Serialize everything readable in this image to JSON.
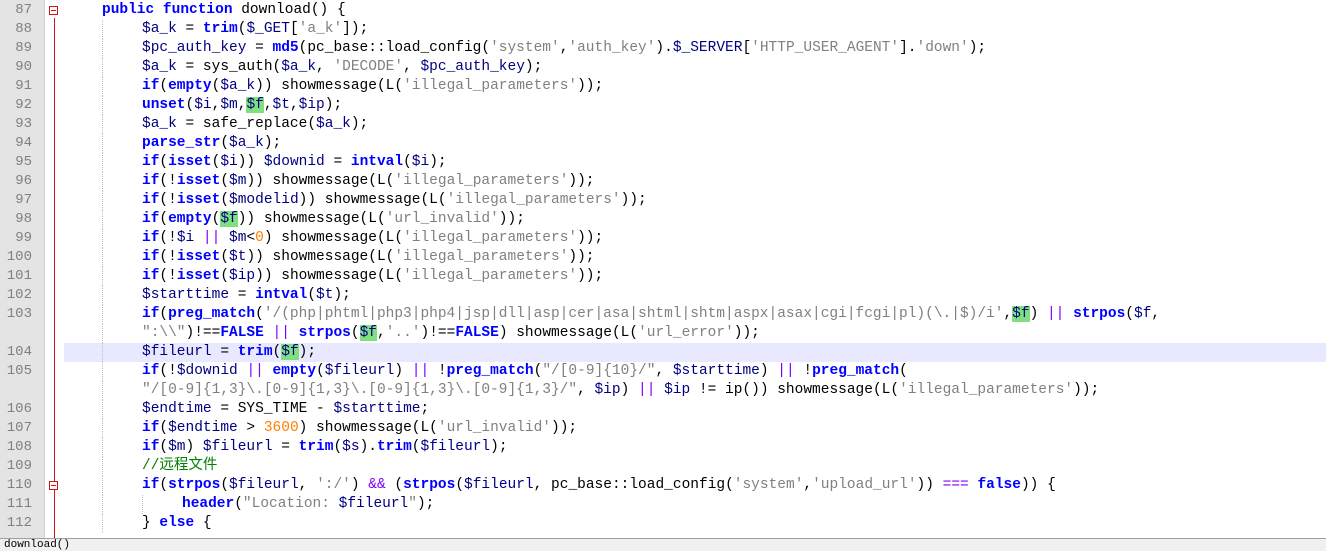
{
  "editor": {
    "fold_markers": [
      87,
      110
    ],
    "current_line": 104,
    "lines": [
      {
        "n": "87",
        "h": "<span class=\"kw\">public function</span> download() {",
        "indent": 1
      },
      {
        "n": "88",
        "h": "<span class=\"var\">$a_k</span> = <span class=\"kw\">trim</span>(<span class=\"var\">$_GET</span>[<span class=\"str\">'a_k'</span>]);",
        "indent": 2
      },
      {
        "n": "89",
        "h": "<span class=\"var\">$pc_auth_key</span> = <span class=\"kw\">md5</span>(pc_base::load_config(<span class=\"str\">'system'</span>,<span class=\"str\">'auth_key'</span>).<span class=\"var\">$_SERVER</span>[<span class=\"str\">'HTTP_USER_AGENT'</span>].<span class=\"str\">'down'</span>);",
        "indent": 2
      },
      {
        "n": "90",
        "h": "<span class=\"var\">$a_k</span> = sys_auth(<span class=\"var\">$a_k</span>, <span class=\"str\">'DECODE'</span>, <span class=\"var\">$pc_auth_key</span>);",
        "indent": 2
      },
      {
        "n": "91",
        "h": "<span class=\"kw\">if</span>(<span class=\"kw\">empty</span>(<span class=\"var\">$a_k</span>)) showmessage(L(<span class=\"str\">'illegal_parameters'</span>));",
        "indent": 2
      },
      {
        "n": "92",
        "h": "<span class=\"kw\">unset</span>(<span class=\"var\">$i</span>,<span class=\"var\">$m</span>,<span class=\"var hl\">$f</span>,<span class=\"var\">$t</span>,<span class=\"var\">$ip</span>);",
        "indent": 2
      },
      {
        "n": "93",
        "h": "<span class=\"var\">$a_k</span> = safe_replace(<span class=\"var\">$a_k</span>);",
        "indent": 2
      },
      {
        "n": "94",
        "h": "<span class=\"kw\">parse_str</span>(<span class=\"var\">$a_k</span>);",
        "indent": 2
      },
      {
        "n": "95",
        "h": "<span class=\"kw\">if</span>(<span class=\"kw\">isset</span>(<span class=\"var\">$i</span>)) <span class=\"var\">$downid</span> = <span class=\"kw\">intval</span>(<span class=\"var\">$i</span>);",
        "indent": 2
      },
      {
        "n": "96",
        "h": "<span class=\"kw\">if</span>(!<span class=\"kw\">isset</span>(<span class=\"var\">$m</span>)) showmessage(L(<span class=\"str\">'illegal_parameters'</span>));",
        "indent": 2
      },
      {
        "n": "97",
        "h": "<span class=\"kw\">if</span>(!<span class=\"kw\">isset</span>(<span class=\"var\">$modelid</span>)) showmessage(L(<span class=\"str\">'illegal_parameters'</span>));",
        "indent": 2
      },
      {
        "n": "98",
        "h": "<span class=\"kw\">if</span>(<span class=\"kw\">empty</span>(<span class=\"var hl\">$f</span>)) showmessage(L(<span class=\"str\">'url_invalid'</span>));",
        "indent": 2
      },
      {
        "n": "99",
        "h": "<span class=\"kw\">if</span>(!<span class=\"var\">$i</span> <span class=\"op\">||</span> <span class=\"var\">$m</span>&lt;<span class=\"num\">0</span>) showmessage(L(<span class=\"str\">'illegal_parameters'</span>));",
        "indent": 2
      },
      {
        "n": "100",
        "h": "<span class=\"kw\">if</span>(!<span class=\"kw\">isset</span>(<span class=\"var\">$t</span>)) showmessage(L(<span class=\"str\">'illegal_parameters'</span>));",
        "indent": 2
      },
      {
        "n": "101",
        "h": "<span class=\"kw\">if</span>(!<span class=\"kw\">isset</span>(<span class=\"var\">$ip</span>)) showmessage(L(<span class=\"str\">'illegal_parameters'</span>));",
        "indent": 2
      },
      {
        "n": "102",
        "h": "<span class=\"var\">$starttime</span> = <span class=\"kw\">intval</span>(<span class=\"var\">$t</span>);",
        "indent": 2
      },
      {
        "n": "103",
        "h": "<span class=\"kw\">if</span>(<span class=\"kw\">preg_match</span>(<span class=\"str\">'/(php|phtml|php3|php4|jsp|dll|asp|cer|asa|shtml|shtm|aspx|asax|cgi|fcgi|pl)(\\.|$)/i'</span>,<span class=\"var hl\">$f</span>) <span class=\"op\">||</span> <span class=\"kw\">strpos</span>(<span class=\"var\">$f</span>,",
        "indent": 2
      },
      {
        "n": "",
        "h": "<span class=\"str\">\":\\\\\"</span>)!==<span class=\"kw\">FALSE</span> <span class=\"op\">||</span> <span class=\"kw\">strpos</span>(<span class=\"var hl\">$f</span>,<span class=\"str\">'..'</span>)!==<span class=\"kw\">FALSE</span>) showmessage(L(<span class=\"str\">'url_error'</span>));",
        "indent": 2
      },
      {
        "n": "104",
        "h": "<span class=\"var\">$fileurl</span> = <span class=\"kw\">trim</span>(<span class=\"var hl\">$f</span>);",
        "indent": 2
      },
      {
        "n": "105",
        "h": "<span class=\"kw\">if</span>(!<span class=\"var\">$downid</span> <span class=\"op\">||</span> <span class=\"kw\">empty</span>(<span class=\"var\">$fileurl</span>) <span class=\"op\">||</span> !<span class=\"kw\">preg_match</span>(<span class=\"str\">\"/[0-9]{10}/\"</span>, <span class=\"var\">$starttime</span>) <span class=\"op\">||</span> !<span class=\"kw\">preg_match</span>(",
        "indent": 2
      },
      {
        "n": "",
        "h": "<span class=\"str\">\"/[0-9]{1,3}\\.[0-9]{1,3}\\.[0-9]{1,3}\\.[0-9]{1,3}/\"</span>, <span class=\"var\">$ip</span>) <span class=\"op\">||</span> <span class=\"var\">$ip</span> != ip()) showmessage(L(<span class=\"str\">'illegal_parameters'</span>));",
        "indent": 2
      },
      {
        "n": "106",
        "h": "<span class=\"var\">$endtime</span> = SYS_TIME - <span class=\"var\">$starttime</span>;",
        "indent": 2
      },
      {
        "n": "107",
        "h": "<span class=\"kw\">if</span>(<span class=\"var\">$endtime</span> &gt; <span class=\"num\">3600</span>) showmessage(L(<span class=\"str\">'url_invalid'</span>));",
        "indent": 2
      },
      {
        "n": "108",
        "h": "<span class=\"kw\">if</span>(<span class=\"var\">$m</span>) <span class=\"var\">$fileurl</span> = <span class=\"kw\">trim</span>(<span class=\"var\">$s</span>).<span class=\"kw\">trim</span>(<span class=\"var\">$fileurl</span>);",
        "indent": 2
      },
      {
        "n": "109",
        "h": "<span class=\"cm\">//远程文件</span>",
        "indent": 2
      },
      {
        "n": "110",
        "h": "<span class=\"kw\">if</span>(<span class=\"kw\">strpos</span>(<span class=\"var\">$fileurl</span>, <span class=\"str\">':/'</span>) <span class=\"op\">&amp;&amp;</span> (<span class=\"kw\">strpos</span>(<span class=\"var\">$fileurl</span>, pc_base::load_config(<span class=\"str\">'system'</span>,<span class=\"str\">'upload_url'</span>)) <span class=\"op\">===</span> <span class=\"kw\">false</span>)) {",
        "indent": 2
      },
      {
        "n": "111",
        "h": "<span class=\"kw\">header</span>(<span class=\"str\">\"Location: </span><span class=\"var\">$fileurl</span><span class=\"str\">\"</span>);",
        "indent": 3
      },
      {
        "n": "112",
        "h": "} <span class=\"kw\">else</span> {",
        "indent": 2
      }
    ]
  },
  "status": {
    "text": "download()"
  }
}
